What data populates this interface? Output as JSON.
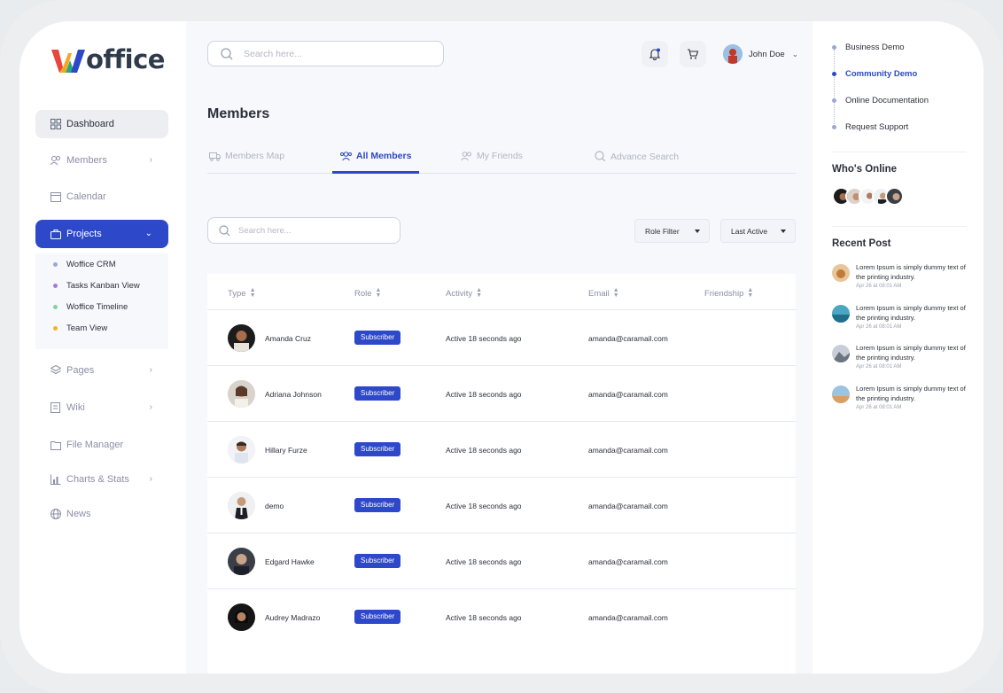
{
  "brand": {
    "name": "offfice_logo",
    "text": "office",
    "colors": [
      "#e8453c",
      "#f5a623",
      "#2aa876",
      "#2d48c8"
    ]
  },
  "sidebar": {
    "items": [
      {
        "label": "Dashboard",
        "icon": "grid-icon"
      },
      {
        "label": "Members",
        "icon": "members-icon"
      },
      {
        "label": "Calendar",
        "icon": "calendar-icon"
      },
      {
        "label": "Projects",
        "icon": "briefcase-icon"
      },
      {
        "label": "Pages",
        "icon": "layers-icon"
      },
      {
        "label": "Wiki",
        "icon": "book-icon"
      },
      {
        "label": "File Manager",
        "icon": "folder-icon"
      },
      {
        "label": "Charts & Stats",
        "icon": "chart-icon"
      },
      {
        "label": "News",
        "icon": "globe-icon"
      }
    ],
    "project_sub": [
      {
        "label": "Woffice CRM",
        "color": "#9aa8d8"
      },
      {
        "label": "Tasks Kanban View",
        "color": "#a07cd8"
      },
      {
        "label": "Woffice Timeline",
        "color": "#7fd3a2"
      },
      {
        "label": "Team View",
        "color": "#f5b323"
      }
    ]
  },
  "header": {
    "search_placeholder": "Search here...",
    "user_name": "John Doe"
  },
  "main": {
    "title": "Members",
    "tabs": [
      {
        "label": "Members Map"
      },
      {
        "label": "All Members"
      },
      {
        "label": "My Friends"
      },
      {
        "label": "Advance Search"
      }
    ],
    "search_placeholder": "Search here...",
    "filters": {
      "role": "Role Filter",
      "sort": "Last Active"
    },
    "columns": [
      "Type",
      "Role",
      "Activity",
      "Email",
      "Friendship"
    ],
    "rows": [
      {
        "name": "Amanda Cruz",
        "role": "Subscriber",
        "activity": "Active 18 seconds ago",
        "email": "amanda@caramail.com"
      },
      {
        "name": "Adriana Johnson",
        "role": "Subscriber",
        "activity": "Active 18 seconds ago",
        "email": "amanda@caramail.com"
      },
      {
        "name": "Hillary Furze",
        "role": "Subscriber",
        "activity": "Active 18 seconds ago",
        "email": "amanda@caramail.com"
      },
      {
        "name": "demo",
        "role": "Subscriber",
        "activity": "Active 18 seconds ago",
        "email": "amanda@caramail.com"
      },
      {
        "name": "Edgard Hawke",
        "role": "Subscriber",
        "activity": "Active 18 seconds ago",
        "email": "amanda@caramail.com"
      },
      {
        "name": "Audrey Madrazo",
        "role": "Subscriber",
        "activity": "Active 18 seconds ago",
        "email": "amanda@caramail.com"
      }
    ]
  },
  "right": {
    "links": [
      {
        "label": "Business Demo"
      },
      {
        "label": "Community Demo"
      },
      {
        "label": "Online Documentation"
      },
      {
        "label": "Request Support"
      }
    ],
    "whos_online": "Who's Online",
    "recent_post": "Recent Post",
    "posts": [
      {
        "text": "Lorem Ipsum is simply dummy text of the printing industry.",
        "date": "Apr 26 at 08:01 AM"
      },
      {
        "text": "Lorem Ipsum is simply dummy text of the printing industry.",
        "date": "Apr 26 at 08:01 AM"
      },
      {
        "text": "Lorem Ipsum is simply dummy text of the printing industry.",
        "date": "Apr 26 at 08:01 AM"
      },
      {
        "text": "Lorem Ipsum is simply dummy text of the printing industry.",
        "date": "Apr 26 at 08:01 AM"
      }
    ]
  }
}
